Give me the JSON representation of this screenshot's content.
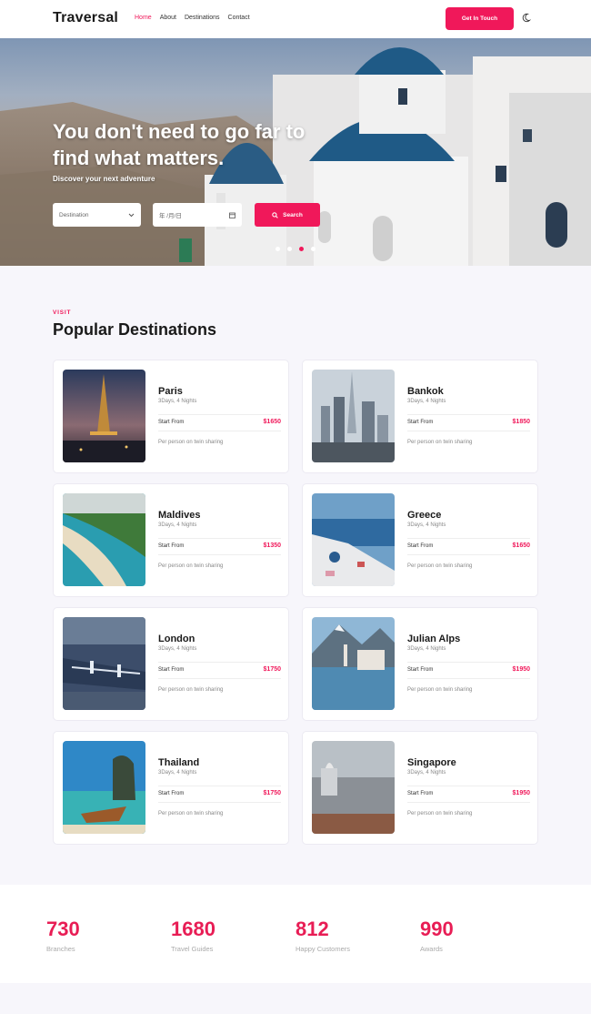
{
  "brand": "Traversal",
  "nav": {
    "items": [
      "Home",
      "About",
      "Destinations",
      "Contact"
    ],
    "active": "Home",
    "cta": "Get In Touch"
  },
  "hero": {
    "title": "You don't need to go far to find what matters.",
    "subtitle": "Discover your next adventure",
    "destination_placeholder": "Destination",
    "date_placeholder": "年 /月/日",
    "search_label": "Search",
    "slides": 4,
    "active_slide": 3
  },
  "section": {
    "eyebrow": "VISIT",
    "title": "Popular Destinations"
  },
  "destinations": [
    {
      "name": "Paris",
      "duration": "3Days, 4 Nights",
      "from_label": "Start From",
      "price": "$1650",
      "note": "Per person on twin sharing"
    },
    {
      "name": "Bankok",
      "duration": "3Days, 4 Nights",
      "from_label": "Start From",
      "price": "$1850",
      "note": "Per person on twin sharing"
    },
    {
      "name": "Maldives",
      "duration": "3Days, 4 Nights",
      "from_label": "Start From",
      "price": "$1350",
      "note": "Per person on twin sharing"
    },
    {
      "name": "Greece",
      "duration": "3Days, 4 Nights",
      "from_label": "Start From",
      "price": "$1650",
      "note": "Per person on twin sharing"
    },
    {
      "name": "London",
      "duration": "3Days, 4 Nights",
      "from_label": "Start From",
      "price": "$1750",
      "note": "Per person on twin sharing"
    },
    {
      "name": "Julian Alps",
      "duration": "3Days, 4 Nights",
      "from_label": "Start From",
      "price": "$1950",
      "note": "Per person on twin sharing"
    },
    {
      "name": "Thailand",
      "duration": "3Days, 4 Nights",
      "from_label": "Start From",
      "price": "$1750",
      "note": "Per person on twin sharing"
    },
    {
      "name": "Singapore",
      "duration": "3Days, 4 Nights",
      "from_label": "Start From",
      "price": "$1950",
      "note": "Per person on twin sharing"
    }
  ],
  "stats": [
    {
      "value": "730",
      "label": "Branches"
    },
    {
      "value": "1680",
      "label": "Travel Guides"
    },
    {
      "value": "812",
      "label": "Happy Customers"
    },
    {
      "value": "990",
      "label": "Awards"
    }
  ],
  "colors": {
    "accent": "#f0185a",
    "dome": "#1f5a86"
  }
}
